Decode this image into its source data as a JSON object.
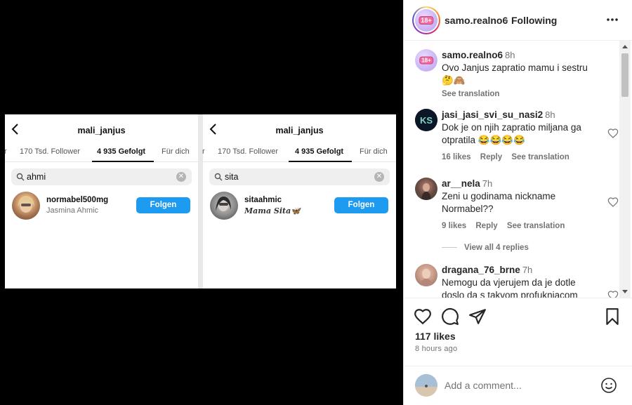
{
  "left_screenshot": {
    "title": "mali_janjus",
    "tabs": [
      "170 Tsd. Follower",
      "4 935 Gefolgt",
      "Für dich"
    ],
    "tab_prefix": "r",
    "search_value": "ahmi",
    "result_username": "normabel500mg",
    "result_fullname": "Jasmina Ahmic",
    "follow_label": "Folgen"
  },
  "right_screenshot": {
    "title": "mali_janjus",
    "tabs": [
      "170 Tsd. Follower",
      "4 935 Gefolgt",
      "Für dich"
    ],
    "tab_prefix": "r",
    "search_value": "sita",
    "result_username": "sitaahmic",
    "result_fullname": "𝑴𝒂𝒎𝒂 𝑺𝒊𝒕𝒂🦋",
    "follow_label": "Folgen"
  },
  "post_header": {
    "username": "samo.realno6",
    "separator": "•",
    "following_label": "Following",
    "avatar_badge": "18+"
  },
  "comments": [
    {
      "username": "samo.realno6",
      "time": "8h",
      "text": "Ovo Janjus zapratio mamu i sestru🤔🙈",
      "meta": [
        "See translation"
      ]
    },
    {
      "username": "jasi_jasi_svi_su_nasi2",
      "time": "8h",
      "text": "Dok je on njih zapratio miljana ga otpratila 😂😂😂😂",
      "meta": [
        "16 likes",
        "Reply",
        "See translation"
      ]
    },
    {
      "username": "ar__nela",
      "time": "7h",
      "text": "Zeni u godinama nickname Normabel??",
      "meta": [
        "9 likes",
        "Reply",
        "See translation"
      ]
    },
    {
      "username": "dragana_76_brne",
      "time": "7h",
      "text": "Nemogu da vjerujem da je dotle doslo da s takvom profuknjacom",
      "meta": []
    }
  ],
  "view_replies_label": "View all 4 replies",
  "likes_label": "117 likes",
  "post_time": "8 hours ago",
  "add_comment_placeholder": "Add a comment...",
  "colors": {
    "follow_button": "#1d9bf0",
    "text_primary": "#262626",
    "text_secondary": "#737373"
  },
  "icons": [
    "back-arrow-icon",
    "search-icon",
    "clear-icon",
    "more-options-icon",
    "heart-icon",
    "comment-icon",
    "share-icon",
    "bookmark-icon",
    "emoji-icon"
  ]
}
